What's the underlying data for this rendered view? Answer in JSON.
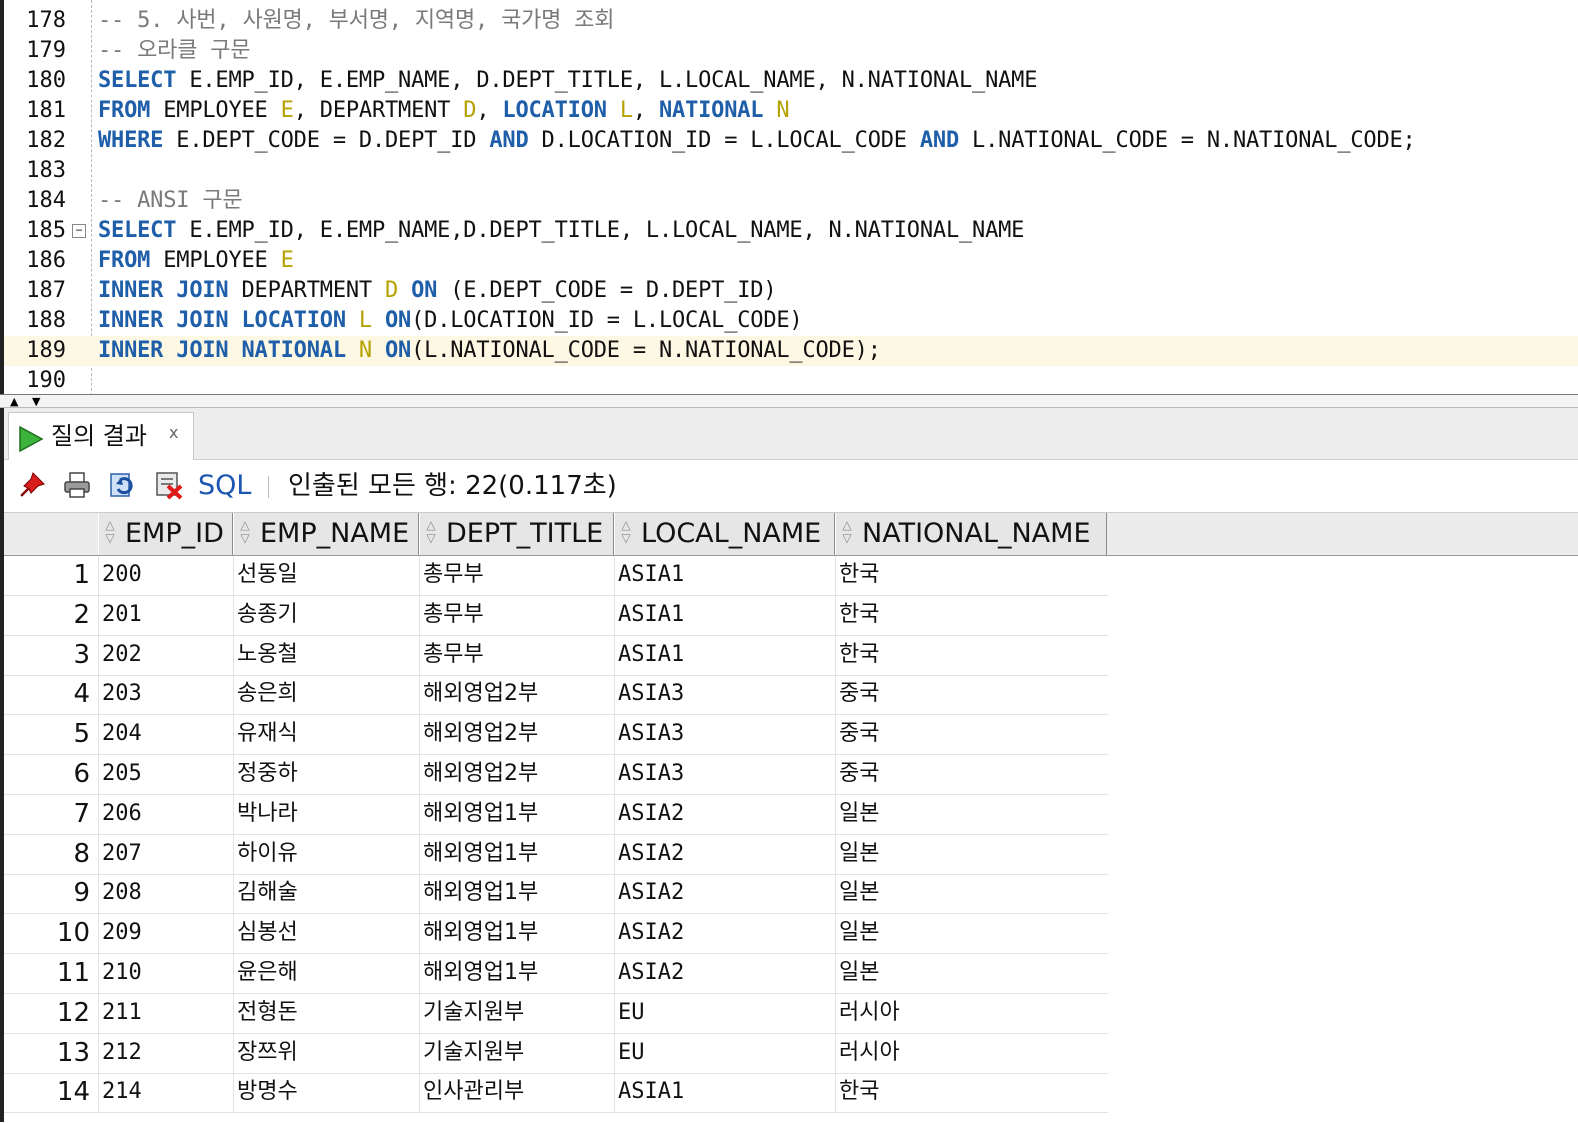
{
  "editor": {
    "lines": [
      {
        "num": "178",
        "tokens": [
          {
            "t": "-- 5. 사번, 사원명, 부서명, 지역명, 국가명 조회",
            "c": "cm"
          }
        ]
      },
      {
        "num": "179",
        "tokens": [
          {
            "t": "-- 오라클 구문",
            "c": "cm"
          }
        ]
      },
      {
        "num": "180",
        "tokens": [
          {
            "t": "SELECT",
            "c": "kw"
          },
          {
            "t": " E.EMP_ID, E.EMP_NAME, D.DEPT_TITLE, L.LOCAL_NAME, N.NATIONAL_NAME",
            "c": ""
          }
        ]
      },
      {
        "num": "181",
        "tokens": [
          {
            "t": "FROM",
            "c": "kw"
          },
          {
            "t": " EMPLOYEE ",
            "c": ""
          },
          {
            "t": "E",
            "c": "al"
          },
          {
            "t": ", DEPARTMENT ",
            "c": ""
          },
          {
            "t": "D",
            "c": "al"
          },
          {
            "t": ", ",
            "c": ""
          },
          {
            "t": "LOCATION",
            "c": "kw"
          },
          {
            "t": " ",
            "c": ""
          },
          {
            "t": "L",
            "c": "al"
          },
          {
            "t": ", ",
            "c": ""
          },
          {
            "t": "NATIONAL",
            "c": "kw"
          },
          {
            "t": " ",
            "c": ""
          },
          {
            "t": "N",
            "c": "al"
          }
        ]
      },
      {
        "num": "182",
        "tokens": [
          {
            "t": "WHERE",
            "c": "kw"
          },
          {
            "t": " E.DEPT_CODE = D.DEPT_ID ",
            "c": ""
          },
          {
            "t": "AND",
            "c": "kw"
          },
          {
            "t": " D.LOCATION_ID = L.LOCAL_CODE ",
            "c": ""
          },
          {
            "t": "AND",
            "c": "kw"
          },
          {
            "t": " L.NATIONAL_CODE = N.NATIONAL_CODE;",
            "c": ""
          }
        ]
      },
      {
        "num": "183",
        "tokens": []
      },
      {
        "num": "184",
        "tokens": [
          {
            "t": "-- ANSI 구문",
            "c": "cm"
          }
        ]
      },
      {
        "num": "185",
        "tokens": [
          {
            "t": "SELECT",
            "c": "kw"
          },
          {
            "t": " E.EMP_ID, E.EMP_NAME,D.DEPT_TITLE, L.LOCAL_NAME, N.NATIONAL_NAME",
            "c": ""
          }
        ],
        "fold": "−"
      },
      {
        "num": "186",
        "tokens": [
          {
            "t": "FROM",
            "c": "kw"
          },
          {
            "t": " EMPLOYEE ",
            "c": ""
          },
          {
            "t": "E",
            "c": "al"
          }
        ]
      },
      {
        "num": "187",
        "tokens": [
          {
            "t": "INNER JOIN",
            "c": "kw"
          },
          {
            "t": " DEPARTMENT ",
            "c": ""
          },
          {
            "t": "D",
            "c": "al"
          },
          {
            "t": " ",
            "c": ""
          },
          {
            "t": "ON",
            "c": "kw"
          },
          {
            "t": " (E.DEPT_CODE = D.DEPT_ID)",
            "c": ""
          }
        ]
      },
      {
        "num": "188",
        "tokens": [
          {
            "t": "INNER JOIN",
            "c": "kw"
          },
          {
            "t": " ",
            "c": ""
          },
          {
            "t": "LOCATION",
            "c": "kw"
          },
          {
            "t": " ",
            "c": ""
          },
          {
            "t": "L",
            "c": "al"
          },
          {
            "t": " ",
            "c": ""
          },
          {
            "t": "ON",
            "c": "kw"
          },
          {
            "t": "(D.LOCATION_ID = L.LOCAL_CODE)",
            "c": ""
          }
        ]
      },
      {
        "num": "189",
        "tokens": [
          {
            "t": "INNER JOIN",
            "c": "kw"
          },
          {
            "t": " ",
            "c": ""
          },
          {
            "t": "NATIONAL",
            "c": "kw"
          },
          {
            "t": " ",
            "c": ""
          },
          {
            "t": "N",
            "c": "al"
          },
          {
            "t": " ",
            "c": ""
          },
          {
            "t": "ON",
            "c": "kw"
          },
          {
            "t": "(L.NATIONAL_CODE = N.NATIONAL_CODE);",
            "c": ""
          }
        ],
        "highlight": true
      },
      {
        "num": "190",
        "tokens": []
      }
    ]
  },
  "results_panel": {
    "tab_label": "질의 결과",
    "tab_close": "x",
    "toolbar": {
      "icons": [
        "pin-icon",
        "print-icon",
        "refresh-icon",
        "delete-icon"
      ],
      "sql_label": "SQL",
      "status": "인출된 모든 행: 22(0.117초)"
    }
  },
  "grid": {
    "columns": [
      "EMP_ID",
      "EMP_NAME",
      "DEPT_TITLE",
      "LOCAL_NAME",
      "NATIONAL_NAME"
    ],
    "rows": [
      [
        "1",
        "200",
        "선동일",
        "총무부",
        "ASIA1",
        "한국"
      ],
      [
        "2",
        "201",
        "송종기",
        "총무부",
        "ASIA1",
        "한국"
      ],
      [
        "3",
        "202",
        "노옹철",
        "총무부",
        "ASIA1",
        "한국"
      ],
      [
        "4",
        "203",
        "송은희",
        "해외영업2부",
        "ASIA3",
        "중국"
      ],
      [
        "5",
        "204",
        "유재식",
        "해외영업2부",
        "ASIA3",
        "중국"
      ],
      [
        "6",
        "205",
        "정중하",
        "해외영업2부",
        "ASIA3",
        "중국"
      ],
      [
        "7",
        "206",
        "박나라",
        "해외영업1부",
        "ASIA2",
        "일본"
      ],
      [
        "8",
        "207",
        "하이유",
        "해외영업1부",
        "ASIA2",
        "일본"
      ],
      [
        "9",
        "208",
        "김해술",
        "해외영업1부",
        "ASIA2",
        "일본"
      ],
      [
        "10",
        "209",
        "심봉선",
        "해외영업1부",
        "ASIA2",
        "일본"
      ],
      [
        "11",
        "210",
        "윤은해",
        "해외영업1부",
        "ASIA2",
        "일본"
      ],
      [
        "12",
        "211",
        "전형돈",
        "기술지원부",
        "EU",
        "러시아"
      ],
      [
        "13",
        "212",
        "장쯔위",
        "기술지원부",
        "EU",
        "러시아"
      ],
      [
        "14",
        "214",
        "방명수",
        "인사관리부",
        "ASIA1",
        "한국"
      ]
    ]
  },
  "colors": {
    "keyword": "#1f5ea8",
    "alias": "#b5a200",
    "comment": "#7a7a7a",
    "current_line": "#fdf8e4",
    "sql_link": "#1a55b0"
  }
}
